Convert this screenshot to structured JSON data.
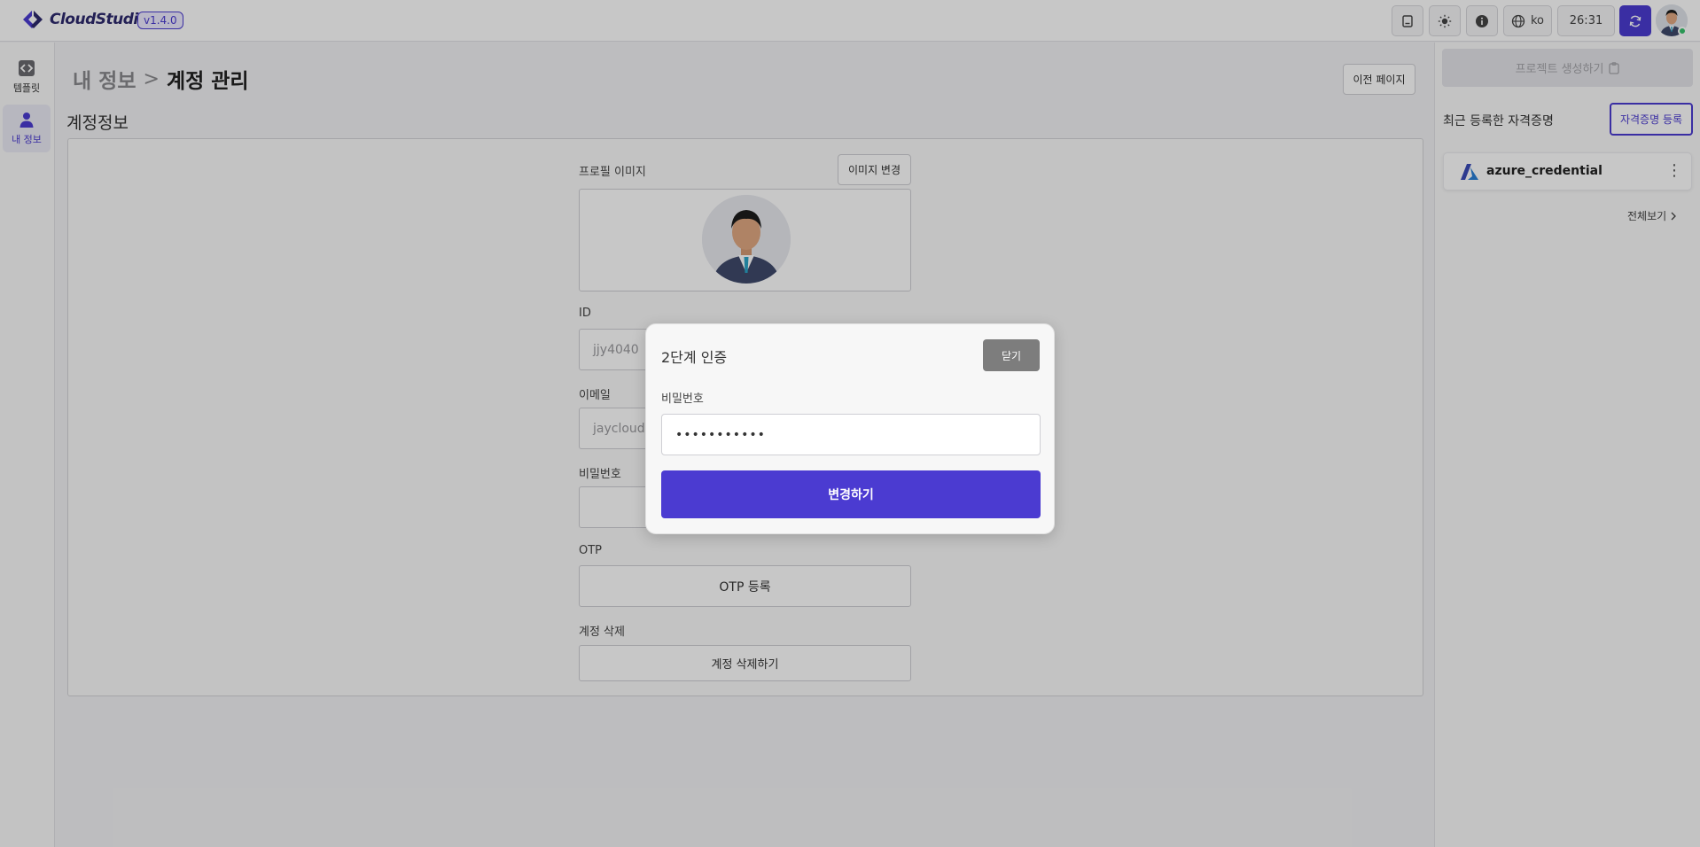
{
  "header": {
    "brand": "CloudStudio",
    "version": "v1.4.0",
    "language": "ko",
    "timer": "26:31",
    "icons": [
      "document-icon",
      "sun-icon",
      "info-icon",
      "globe-icon",
      "sync-icon"
    ]
  },
  "leftnav": {
    "items": [
      {
        "label": "템플릿",
        "icon": "template-icon",
        "active": false
      },
      {
        "label": "내 정보",
        "icon": "user-icon",
        "active": true
      }
    ]
  },
  "main": {
    "breadcrumb": {
      "parent": "내 정보",
      "separator": ">",
      "current": "계정 관리"
    },
    "back_label": "이전 페이지",
    "section_title": "계정정보",
    "profile": {
      "label": "프로필 이미지",
      "change_label": "이미지 변경"
    },
    "id": {
      "label": "ID",
      "value": "jjy4040"
    },
    "email": {
      "label": "이메일",
      "value": "jaycloud"
    },
    "password": {
      "label": "비밀번호",
      "value": ""
    },
    "otp": {
      "label": "OTP",
      "button_label": "OTP 등록"
    },
    "delete": {
      "label": "계정 삭제",
      "button_label": "계정 삭제하기"
    }
  },
  "rightpanel": {
    "create_label": "프로젝트 생성하기",
    "recent_title": "최근 등록한 자격증명",
    "register_label": "자격증명 등록",
    "credentials": [
      {
        "name": "azure_credential",
        "icon": "azure-icon"
      }
    ],
    "view_all_label": "전체보기"
  },
  "modal": {
    "title": "2단계 인증",
    "close_label": "닫기",
    "password_label": "비밀번호",
    "password_value": "•••••••••••",
    "submit_label": "변경하기"
  },
  "colors": {
    "accent": "#4b3bd1",
    "online": "#37c26c",
    "close_button": "#7d7d7d"
  }
}
